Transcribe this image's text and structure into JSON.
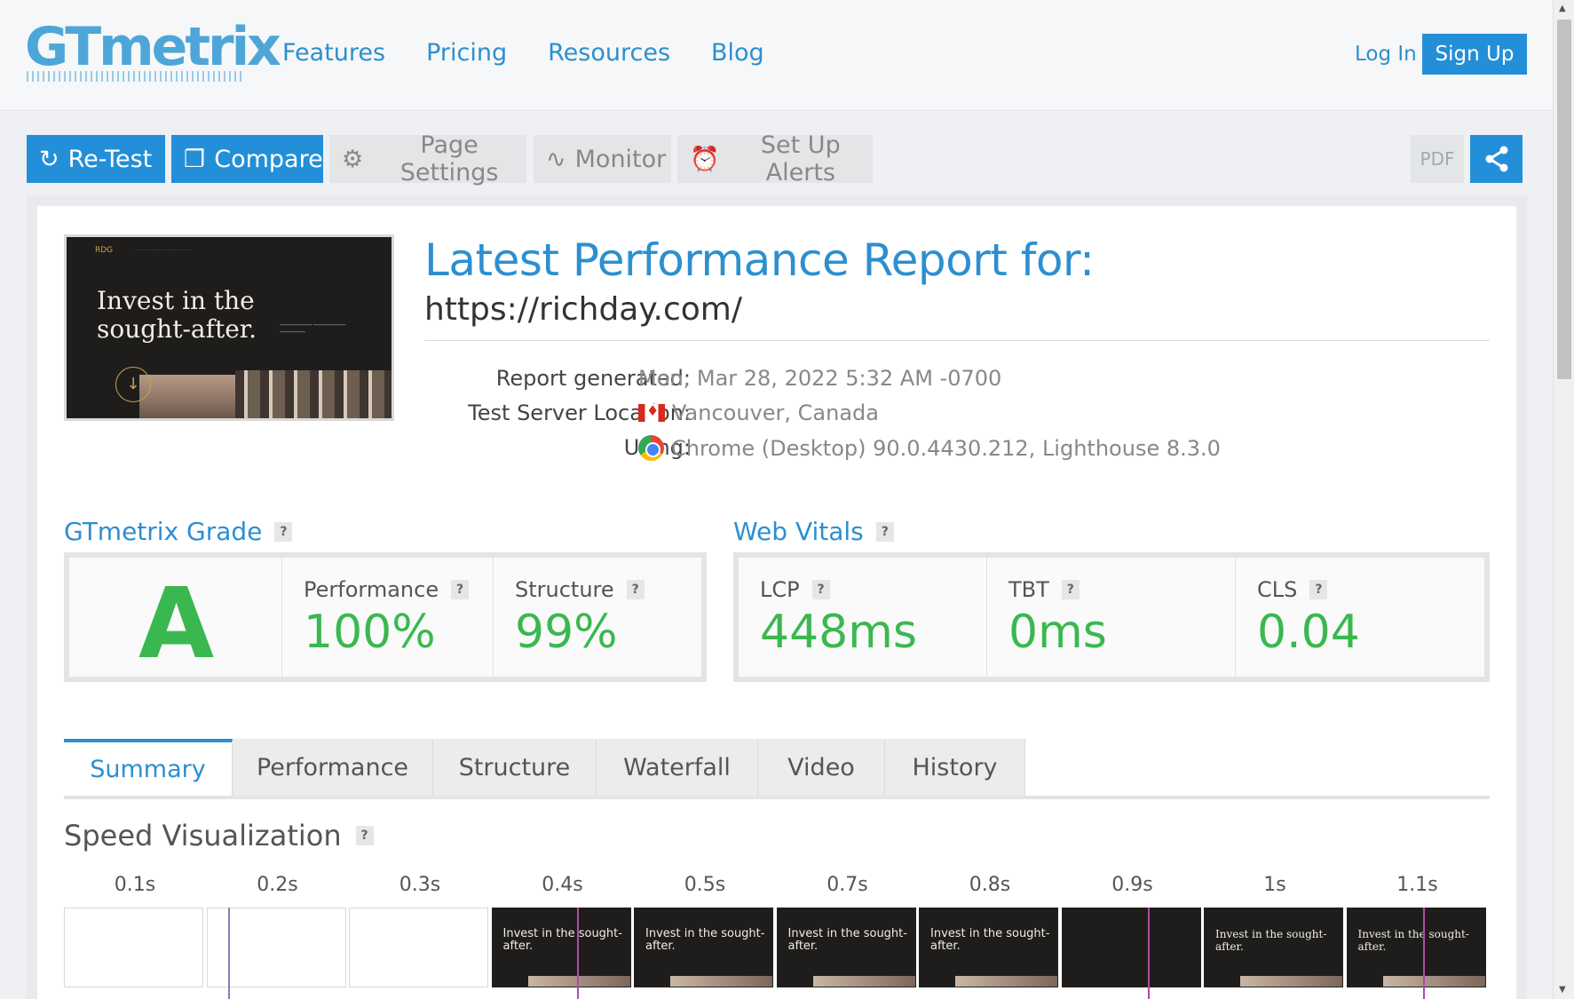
{
  "header": {
    "logo": "GTmetrix",
    "nav": [
      "Features",
      "Pricing",
      "Resources",
      "Blog"
    ],
    "login": "Log In",
    "signup": "Sign Up"
  },
  "toolbar": {
    "retest": "Re-Test",
    "compare": "Compare",
    "page_settings": "Page Settings",
    "monitor": "Monitor",
    "alerts": "Set Up Alerts",
    "pdf": "PDF"
  },
  "thumbnail": {
    "brand": "RDG",
    "headline_line1": "Invest in the",
    "headline_line2": "sought-after."
  },
  "report": {
    "title": "Latest Performance Report for:",
    "url": "https://richday.com/",
    "rows": [
      {
        "label": "Report generated:",
        "value": "Mon, Mar 28, 2022 5:32 AM -0700"
      },
      {
        "label": "Test Server Location:",
        "value": "Vancouver, Canada"
      },
      {
        "label": "Using:",
        "value": "Chrome (Desktop) 90.0.4430.212, Lighthouse 8.3.0"
      }
    ]
  },
  "grade": {
    "title": "GTmetrix Grade",
    "letter": "A",
    "performance_label": "Performance",
    "performance_value": "100%",
    "structure_label": "Structure",
    "structure_value": "99%"
  },
  "vitals": {
    "title": "Web Vitals",
    "lcp_label": "LCP",
    "lcp_value": "448ms",
    "tbt_label": "TBT",
    "tbt_value": "0ms",
    "cls_label": "CLS",
    "cls_value": "0.04"
  },
  "tabs": [
    "Summary",
    "Performance",
    "Structure",
    "Waterfall",
    "Video",
    "History"
  ],
  "help_mark": "?",
  "speed": {
    "title": "Speed Visualization",
    "frames": [
      {
        "time": "0.1s",
        "text": ""
      },
      {
        "time": "0.2s",
        "text": ""
      },
      {
        "time": "0.3s",
        "text": ""
      },
      {
        "time": "0.4s",
        "text": "Invest in the sought-after."
      },
      {
        "time": "0.5s",
        "text": "Invest in the sought-after."
      },
      {
        "time": "0.7s",
        "text": "Invest in the sought-after."
      },
      {
        "time": "0.8s",
        "text": "Invest in the sought-after."
      },
      {
        "time": "0.9s",
        "text": ""
      },
      {
        "time": "1s",
        "text": "Invest in the sought-after."
      },
      {
        "time": "1.1s",
        "text": "Invest in the sought-after."
      }
    ]
  },
  "colors": {
    "brand_blue": "#2c8fd0",
    "button_blue": "#238fd8",
    "grade_green": "#3ab84f",
    "marker_blue": "#7b83b6",
    "marker_purple": "#b04aa8"
  }
}
